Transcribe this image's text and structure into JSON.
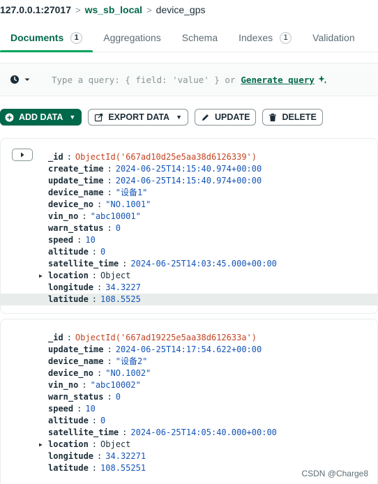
{
  "breadcrumb": {
    "host": "127.0.0.1:27017",
    "database": "ws_sb_local",
    "collection": "device_gps"
  },
  "tabs": [
    {
      "label": "Documents",
      "count": "1",
      "active": true
    },
    {
      "label": "Aggregations"
    },
    {
      "label": "Schema"
    },
    {
      "label": "Indexes",
      "count": "1"
    },
    {
      "label": "Validation"
    }
  ],
  "query": {
    "placeholder": "Type a query: { field: 'value' } or",
    "generate_label": "Generate query"
  },
  "toolbar": {
    "add_data": "ADD DATA",
    "export_data": "EXPORT DATA",
    "update": "UPDATE",
    "delete": "DELETE"
  },
  "documents": [
    {
      "fields": [
        {
          "key": "_id",
          "value": "ObjectId('667ad10d25e5aa38d6126339')"
        },
        {
          "key": "create_time",
          "value": "2024-06-25T14:15:40.974+00:00"
        },
        {
          "key": "update_time",
          "value": "2024-06-25T14:15:40.974+00:00"
        },
        {
          "key": "device_name",
          "value": "\"设备1\""
        },
        {
          "key": "device_no",
          "value": "\"NO.1001\""
        },
        {
          "key": "vin_no",
          "value": "\"abc10001\""
        },
        {
          "key": "warn_status",
          "value": "0"
        },
        {
          "key": "speed",
          "value": "10"
        },
        {
          "key": "altitude",
          "value": "0"
        },
        {
          "key": "satellite_time",
          "value": "2024-06-25T14:03:45.000+00:00"
        },
        {
          "key": "location",
          "value": "Object"
        },
        {
          "key": "longitude",
          "value": "34.3227"
        },
        {
          "key": "latitude",
          "value": "108.5525"
        }
      ]
    },
    {
      "fields": [
        {
          "key": "_id",
          "value": "ObjectId('667ad19225e5aa38d612633a')"
        },
        {
          "key": "update_time",
          "value": "2024-06-25T14:17:54.622+00:00"
        },
        {
          "key": "device_name",
          "value": "\"设备2\""
        },
        {
          "key": "device_no",
          "value": "\"NO.1002\""
        },
        {
          "key": "vin_no",
          "value": "\"abc10002\""
        },
        {
          "key": "warn_status",
          "value": "0"
        },
        {
          "key": "speed",
          "value": "10"
        },
        {
          "key": "altitude",
          "value": "0"
        },
        {
          "key": "satellite_time",
          "value": "2024-06-25T14:05:40.000+00:00"
        },
        {
          "key": "location",
          "value": "Object"
        },
        {
          "key": "longitude",
          "value": "34.32271"
        },
        {
          "key": "latitude",
          "value": "108.55251"
        }
      ]
    }
  ],
  "watermark": "CSDN @Charge8",
  "colors": {
    "brand_green": "#00684a",
    "tab_underline": "#00a35c",
    "oid_red": "#c24422",
    "value_blue": "#1254b7"
  },
  "icons": [
    "clock-icon",
    "chevron-down-icon",
    "sparkle-icon",
    "plus-circle-icon",
    "export-icon",
    "pencil-icon",
    "trash-icon",
    "expand-icon",
    "caret-right-icon"
  ]
}
